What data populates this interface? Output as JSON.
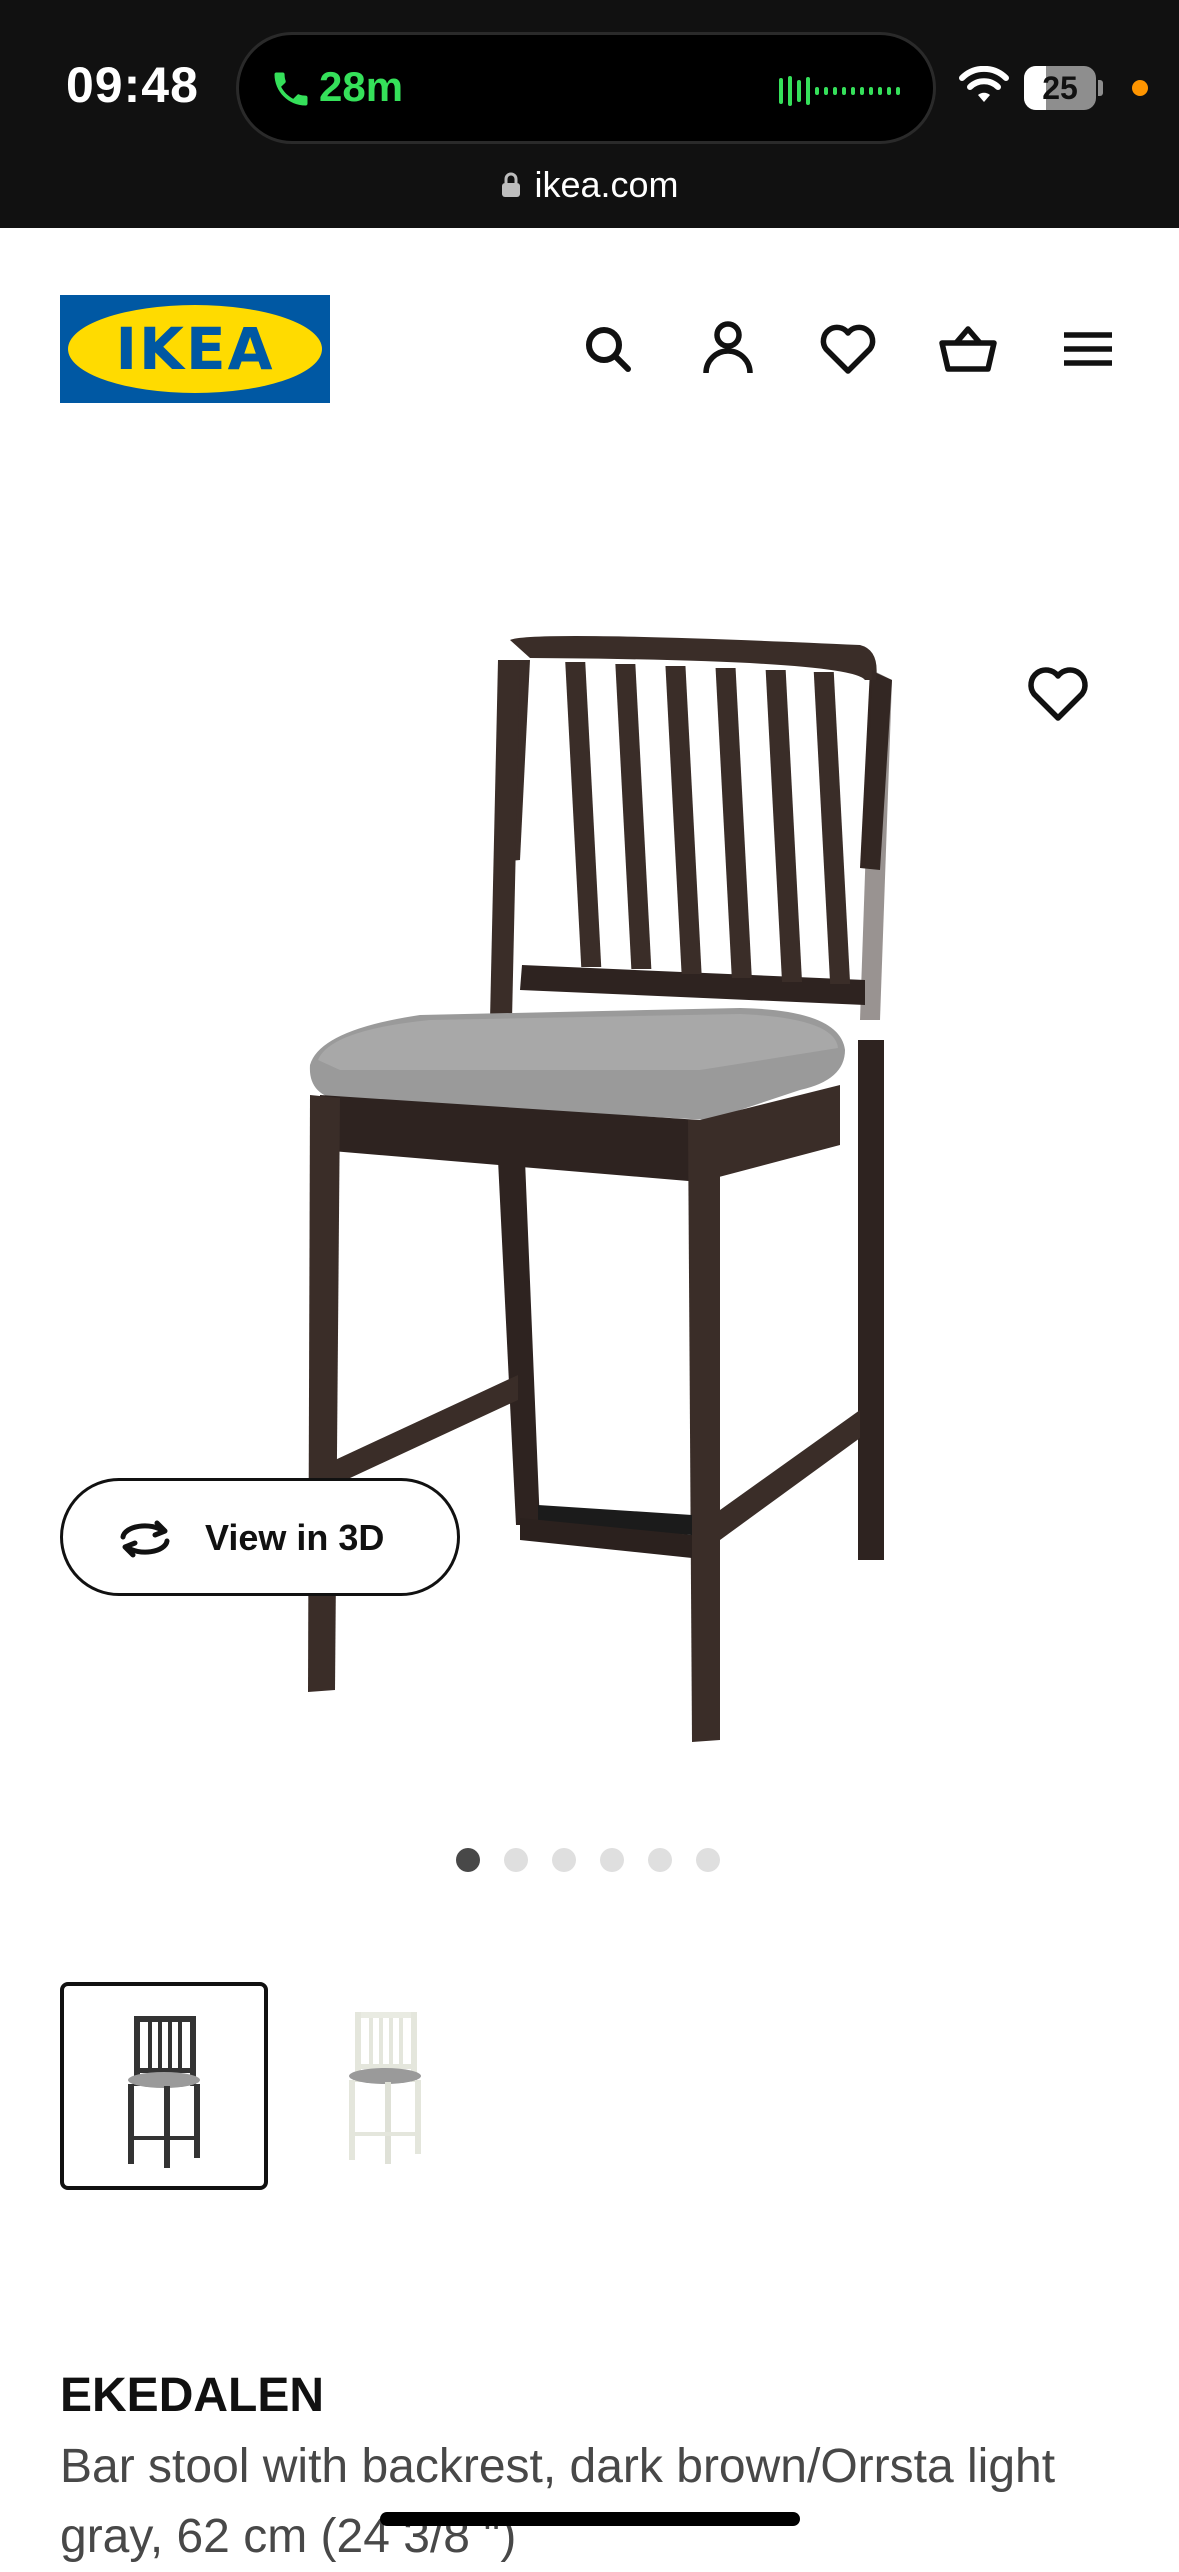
{
  "status_bar": {
    "time": "09:48",
    "call_duration": "28m",
    "battery_level": "25",
    "url": "ikea.com",
    "accent_call_color": "#35e05a",
    "recording_dot_color": "#ff9500"
  },
  "header": {
    "logo_text": "IKEA",
    "brand_blue": "#0058a3",
    "brand_yellow": "#ffdb00",
    "icons": [
      "search-icon",
      "account-icon",
      "favorites-icon",
      "cart-icon",
      "menu-icon"
    ]
  },
  "gallery": {
    "view_3d_label": "View in 3D",
    "dot_count": 6,
    "active_dot": 1,
    "thumbnails": [
      "dark brown stool",
      "white stool"
    ],
    "active_thumbnail": 1
  },
  "product": {
    "name": "EKEDALEN",
    "description": "Bar stool with backrest, dark brown/Orrsta light gray, 62 cm (24 3/8 \")"
  }
}
